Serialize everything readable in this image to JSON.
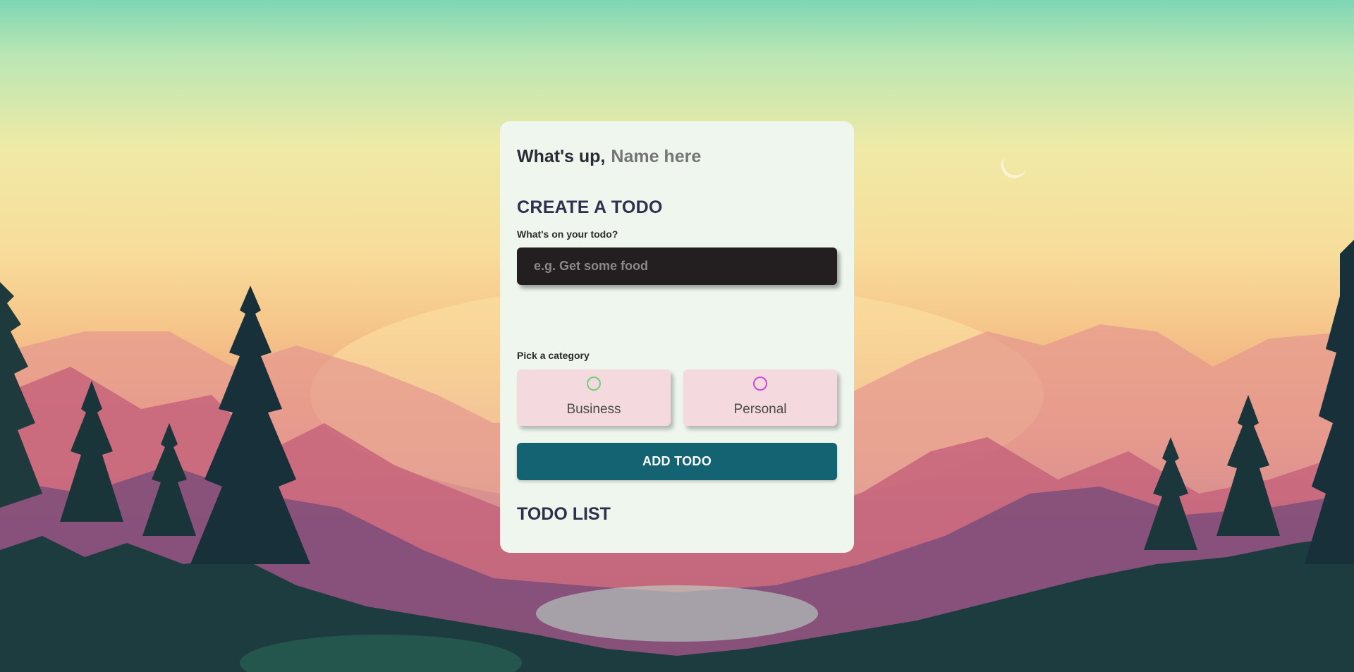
{
  "greeting": {
    "prefix": "What's up,",
    "name_placeholder": "Name here"
  },
  "create": {
    "heading": "CREATE A TODO",
    "todo_label": "What's on your todo?",
    "todo_placeholder": "e.g. Get some food"
  },
  "category": {
    "label": "Pick a category",
    "options": [
      {
        "label": "Business",
        "color": "#6cd37a"
      },
      {
        "label": "Personal",
        "color": "#c74ad8"
      }
    ]
  },
  "add_button": {
    "label": "ADD TODO"
  },
  "list": {
    "heading": "TODO LIST"
  },
  "colors": {
    "card": "#eef6ee",
    "input_bg": "#231f20",
    "category_bg": "#f4d9de",
    "button_bg": "#136373",
    "heading": "#2f2f4e"
  }
}
